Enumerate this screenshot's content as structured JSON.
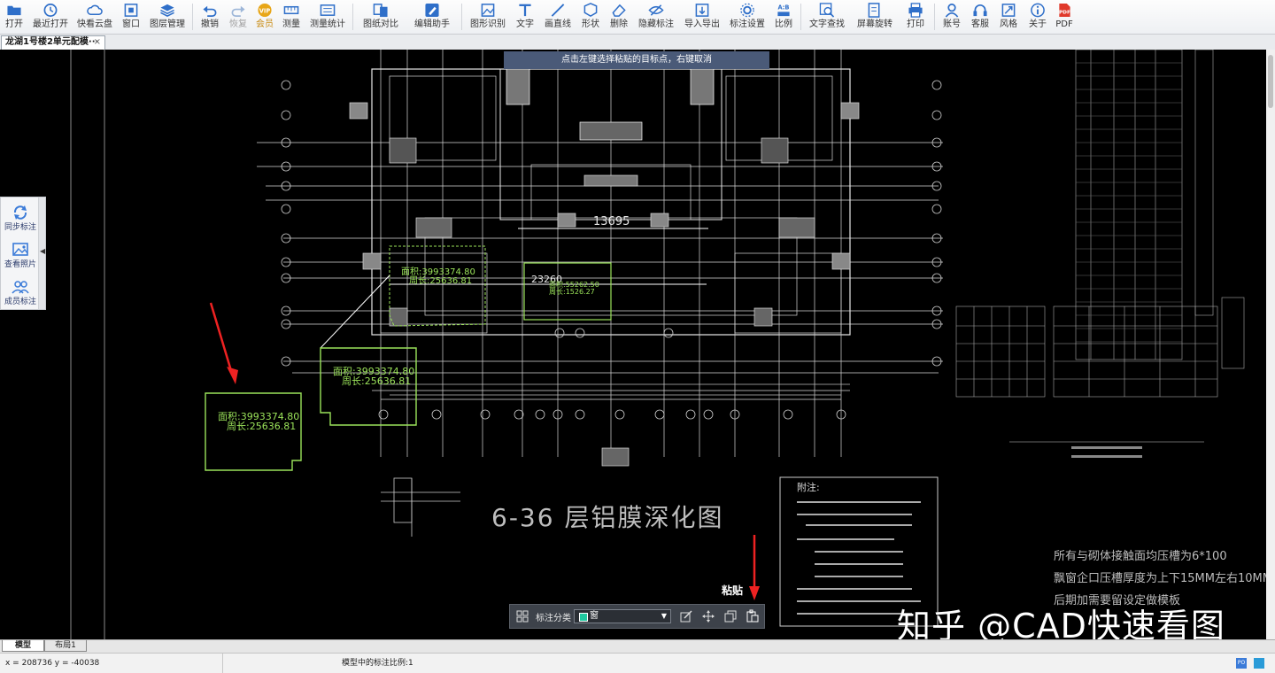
{
  "toolbar": {
    "items": [
      {
        "label": "打开",
        "icon": "folder-icon"
      },
      {
        "label": "最近打开",
        "icon": "clock-icon"
      },
      {
        "label": "快看云盘",
        "icon": "cloud-icon"
      },
      {
        "label": "窗口",
        "icon": "window-icon"
      },
      {
        "label": "图层管理",
        "icon": "layers-icon"
      },
      {
        "label": "撤销",
        "icon": "undo-icon"
      },
      {
        "label": "恢复",
        "icon": "redo-icon"
      },
      {
        "label": "会员",
        "icon": "vip-icon",
        "badge": "VIP"
      },
      {
        "label": "测量",
        "icon": "ruler-icon"
      },
      {
        "label": "测量统计",
        "icon": "measure-stats-icon"
      },
      {
        "label": "图纸对比",
        "icon": "compare-icon"
      },
      {
        "label": "编辑助手",
        "icon": "edit-assistant-icon"
      },
      {
        "label": "图形识别",
        "icon": "shape-recognize-icon"
      },
      {
        "label": "文字",
        "icon": "text-icon"
      },
      {
        "label": "画直线",
        "icon": "line-icon"
      },
      {
        "label": "形状",
        "icon": "shape-icon"
      },
      {
        "label": "删除",
        "icon": "eraser-icon"
      },
      {
        "label": "隐藏标注",
        "icon": "hide-annotation-icon"
      },
      {
        "label": "导入导出",
        "icon": "import-export-icon"
      },
      {
        "label": "标注设置",
        "icon": "annotation-settings-icon"
      },
      {
        "label": "比例",
        "icon": "scale-icon",
        "badge": "A:B"
      },
      {
        "label": "文字查找",
        "icon": "text-search-icon"
      },
      {
        "label": "屏幕旋转",
        "icon": "rotate-screen-icon"
      },
      {
        "label": "打印",
        "icon": "printer-icon"
      },
      {
        "label": "账号",
        "icon": "user-icon"
      },
      {
        "label": "客服",
        "icon": "headset-icon"
      },
      {
        "label": "风格",
        "icon": "style-icon"
      },
      {
        "label": "关于",
        "icon": "info-icon"
      },
      {
        "label": "PDF",
        "icon": "pdf-icon"
      }
    ]
  },
  "document_tab": {
    "title": "龙湖1号楼2单元配模···",
    "close": "×"
  },
  "hint_text": "点击左键选择粘贴的目标点，右键取消",
  "left_panel": {
    "items": [
      {
        "label": "同步标注",
        "icon": "sync-icon"
      },
      {
        "label": "查看照片",
        "icon": "photo-icon"
      },
      {
        "label": "成员标注",
        "icon": "members-icon"
      }
    ],
    "collapse": "◀"
  },
  "drawing": {
    "title": "6-36 层铝膜深化图",
    "dim_top": "13695",
    "dim_mid": "23260",
    "area_tag_1": "面积:3993374.80",
    "perim_tag_1": "周长:25636.81",
    "area_tag_2": "面积:3993374.80",
    "perim_tag_2": "周长:25636.81",
    "area_tag_3": "面积:3993374.80",
    "perim_tag_3": "周长:25636.81",
    "area_tag_4": "面积:55262.50",
    "perim_tag_4": "周长:1526.27",
    "notes_title": "附注:",
    "right_note_1": "所有与砌体接触面均压槽为6*100",
    "right_note_2": "飘窗企口压槽厚度为上下15MM左右10MM",
    "right_note_3": "后期加需要留设定做模板",
    "paste_label": "粘贴"
  },
  "bottom_toolbar": {
    "category_label": "标注分类",
    "category_value": "窗",
    "category_color": "#20c9a0"
  },
  "sheet_tabs": [
    {
      "label": "模型",
      "active": true
    },
    {
      "label": "布局1",
      "active": false
    }
  ],
  "status": {
    "coords": "x = 208736  y = -40038",
    "scale": "模型中的标注比例:1"
  },
  "watermark": "知乎 @CAD快速看图",
  "colors": {
    "toolbar_icon": "#2f6fc9",
    "area_outline": "#9be35a",
    "cad_line": "#ffffff",
    "hint_bg": "#4a5a78"
  }
}
